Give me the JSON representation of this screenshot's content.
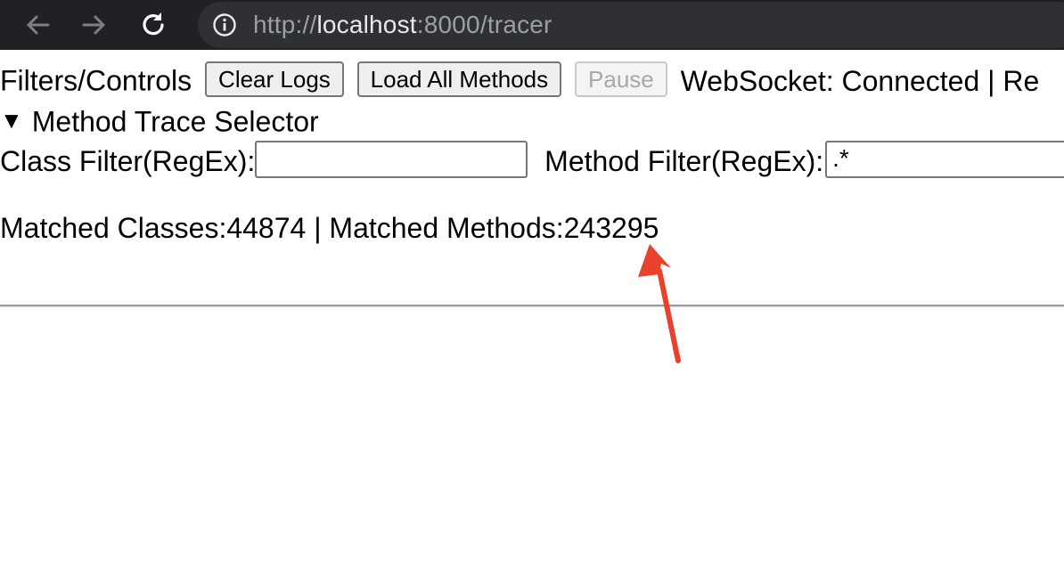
{
  "browser": {
    "back_icon": "arrow-left-icon",
    "forward_icon": "arrow-right-icon",
    "reload_icon": "reload-icon",
    "site_info_icon": "info-circle-icon",
    "url_scheme": "http://",
    "url_host": "localhost",
    "url_rest": ":8000/tracer"
  },
  "controls": {
    "heading": "Filters/Controls",
    "clear_logs_label": "Clear Logs",
    "load_all_methods_label": "Load All Methods",
    "pause_label": "Pause",
    "status_text": "WebSocket: Connected | Re"
  },
  "selector": {
    "toggle_glyph": "▼",
    "title": "Method Trace Selector",
    "class_filter_label": "Class Filter(RegEx):",
    "class_filter_value": "",
    "method_filter_label": "Method Filter(RegEx):",
    "method_filter_value": ".*"
  },
  "summary": {
    "text": "Matched Classes:44874 | Matched Methods:243295"
  },
  "annotation": {
    "arrow_color": "#e8412c"
  }
}
